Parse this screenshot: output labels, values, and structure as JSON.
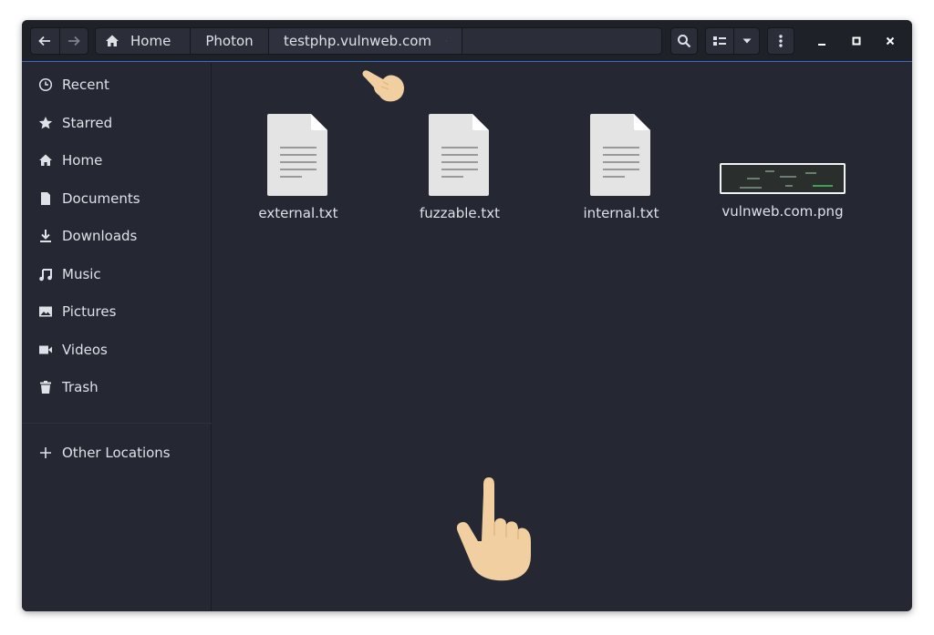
{
  "breadcrumb": {
    "items": [
      {
        "label": "Home"
      },
      {
        "label": "Photon"
      },
      {
        "label": "testphp.vulnweb.com"
      }
    ]
  },
  "sidebar": {
    "items": [
      {
        "label": "Recent",
        "icon": "clock-icon"
      },
      {
        "label": "Starred",
        "icon": "star-icon"
      },
      {
        "label": "Home",
        "icon": "home-icon"
      },
      {
        "label": "Documents",
        "icon": "document-icon"
      },
      {
        "label": "Downloads",
        "icon": "download-icon"
      },
      {
        "label": "Music",
        "icon": "music-icon"
      },
      {
        "label": "Pictures",
        "icon": "picture-icon"
      },
      {
        "label": "Videos",
        "icon": "video-icon"
      },
      {
        "label": "Trash",
        "icon": "trash-icon"
      }
    ],
    "other_locations": {
      "label": "Other Locations",
      "icon": "plus-icon"
    }
  },
  "files": [
    {
      "name": "external.txt",
      "type": "text"
    },
    {
      "name": "fuzzable.txt",
      "type": "text"
    },
    {
      "name": "internal.txt",
      "type": "text"
    },
    {
      "name": "vulnweb.com.png",
      "type": "image"
    }
  ],
  "colors": {
    "window_bg": "#252833",
    "header_bg": "#1f2129",
    "accent": "#3d6dbf",
    "text": "#dfe1e6",
    "file_icon": "#e4e4e4",
    "hand": "#f1cfa0"
  }
}
